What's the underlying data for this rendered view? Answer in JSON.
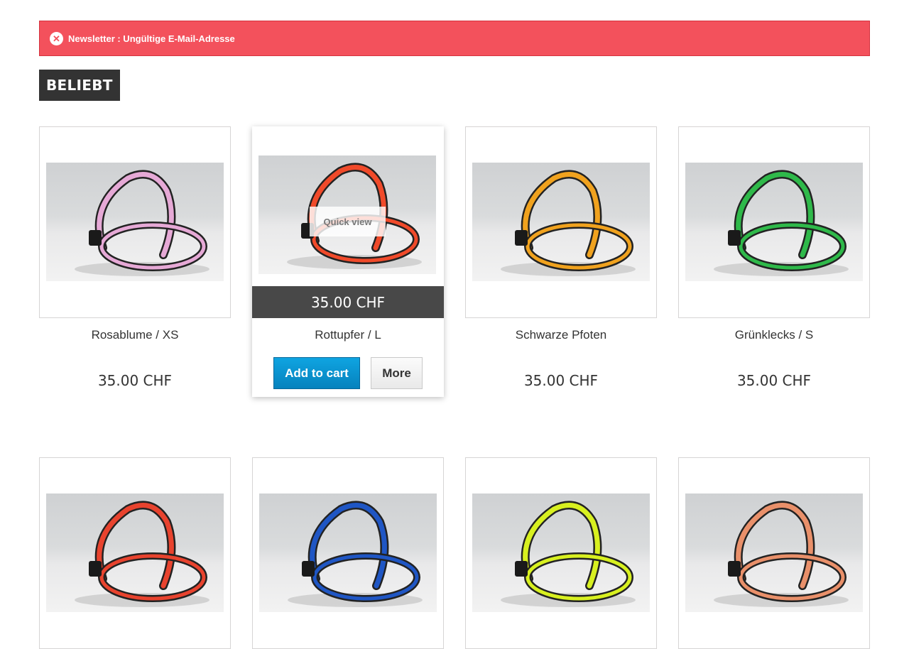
{
  "alert": {
    "icon": "close-circle-icon",
    "message": "Newsletter : Ungültige E-Mail-Adresse",
    "color": "#f3515c"
  },
  "section": {
    "title": "BELIEBT"
  },
  "products": [
    {
      "name": "Rosablume / XS",
      "price": "35.00 CHF",
      "color": "#e6a9d6"
    },
    {
      "name": "Rottupfer / L",
      "price": "35.00 CHF",
      "color": "#f04a2a",
      "quick_view": "Quick view",
      "add_to_cart": "Add to cart",
      "more": "More"
    },
    {
      "name": "Schwarze Pfoten",
      "price": "35.00 CHF",
      "color": "#f0a21e"
    },
    {
      "name": "Grünklecks / S",
      "price": "35.00 CHF",
      "color": "#2fb94a"
    },
    {
      "color": "#e8432e"
    },
    {
      "color": "#1f56c4"
    },
    {
      "color": "#d8f020"
    },
    {
      "color": "#e9906a"
    }
  ],
  "colors": {
    "cart_button": "#0682bd",
    "price_bar": "#484848",
    "title_bg": "#333333"
  }
}
